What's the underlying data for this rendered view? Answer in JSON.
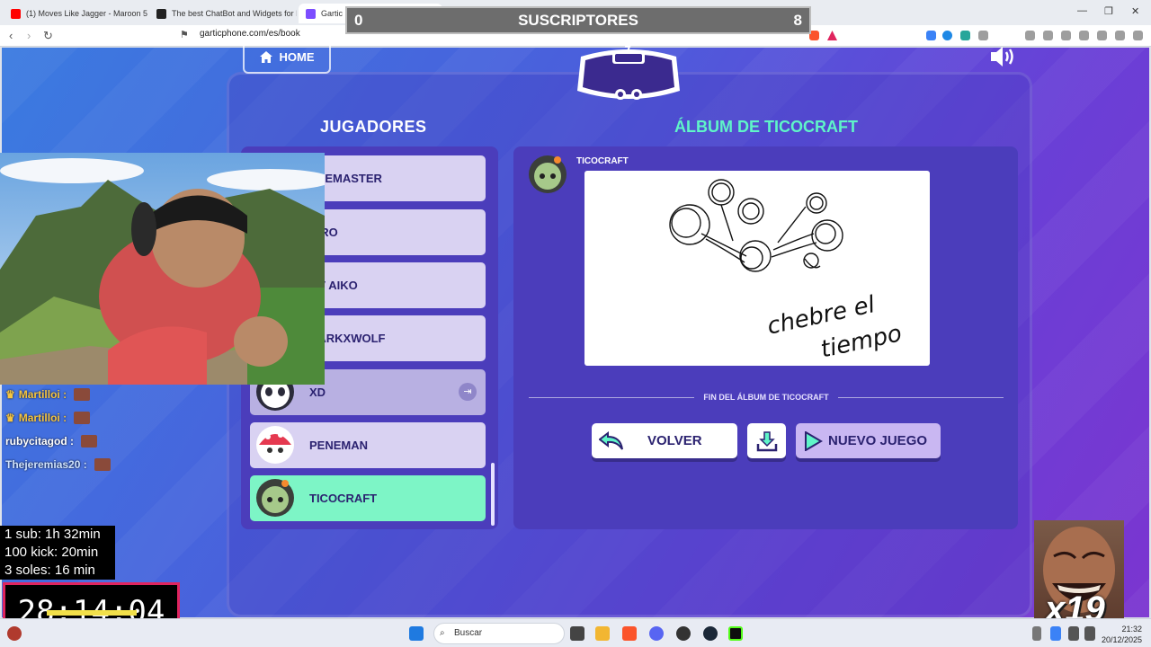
{
  "browser": {
    "tabs": [
      {
        "label": "(1) Moves Like Jagger - Maroon 5",
        "color": "#ff0000"
      },
      {
        "label": "The best ChatBot and Widgets for Ki...",
        "color": "#222222"
      },
      {
        "label": "Gartic Phone - Teléfono Descomp...",
        "color": "#7c4dff"
      }
    ],
    "url": "garticphone.com/es/book"
  },
  "game": {
    "home_label": "HOME",
    "players_heading": "JUGADORES",
    "album_heading": "ÁLBUM DE TICOCRAFT",
    "players": [
      {
        "name": "EYEMASTER"
      },
      {
        "name": "YIRO"
      },
      {
        "name": "NV AIKO"
      },
      {
        "name": "DARKXWOLF"
      },
      {
        "name": "XD"
      },
      {
        "name": "PENEMAN"
      },
      {
        "name": "TICOCRAFT"
      }
    ],
    "album_author": "TICOCRAFT",
    "drawing_text_line1": "chebre el",
    "drawing_text_line2": "tiempo",
    "end_text": "FIN DEL ÁLBUM DE TICOCRAFT",
    "back_label": "VOLVER",
    "new_game_label": "NUEVO JUEGO",
    "accent": "#5ff5c8"
  },
  "stream": {
    "subs_left": "0",
    "subs_title": "SUSCRIPTORES",
    "subs_right": "8",
    "chat": [
      {
        "user": "Martilloi :",
        "crown": true
      },
      {
        "user": "Martilloi :",
        "crown": true
      },
      {
        "user": "rubycitagod :",
        "crown": false
      },
      {
        "user": "Thejeremias20 :",
        "crown": false
      }
    ],
    "goals": [
      "1 sub: 1h 32min",
      "100 kick: 20min",
      "3 soles: 16 min"
    ],
    "timer": "28:14:04",
    "meme_count": "x19"
  },
  "taskbar": {
    "search_placeholder": "Buscar",
    "time": "21:32",
    "date": "20/12/2025"
  }
}
